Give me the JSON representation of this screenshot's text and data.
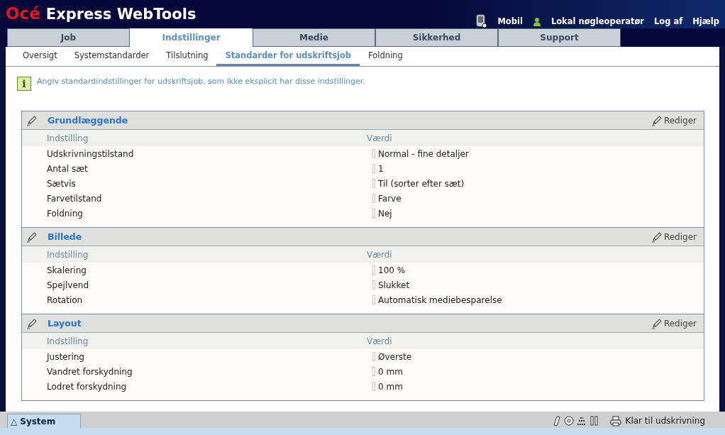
{
  "app": {
    "brand": "Océ",
    "title": "Express WebTools"
  },
  "top_links": [
    {
      "label": "Mobil",
      "kind": "mobile"
    },
    {
      "label": "Lokal nøgleoperatør",
      "kind": "user"
    },
    {
      "label": "Log af",
      "kind": "plain"
    },
    {
      "label": "Hjælp",
      "kind": "plain"
    }
  ],
  "tabs": [
    {
      "label": "Job",
      "selected": false
    },
    {
      "label": "Indstillinger",
      "selected": true
    },
    {
      "label": "Medie",
      "selected": false
    },
    {
      "label": "Sikkerhed",
      "selected": false
    },
    {
      "label": "Support",
      "selected": false
    }
  ],
  "subtabs": [
    {
      "label": "Oversigt",
      "selected": false
    },
    {
      "label": "Systemstandarder",
      "selected": false
    },
    {
      "label": "Tilslutning",
      "selected": false
    },
    {
      "label": "Standarder for udskriftsjob",
      "selected": true
    },
    {
      "label": "Foldning",
      "selected": false
    }
  ],
  "info_symbol": "i",
  "info": "Angiv standardindstillinger for udskriftsjob, som ikke eksplicit har disse indstillinger.",
  "sections": [
    {
      "title": "Grundlæggende",
      "edit": "Rediger",
      "columns": [
        "Indstilling",
        "Værdi"
      ],
      "rows": [
        [
          "Udskrivningstilstand",
          "Normal - fine detaljer"
        ],
        [
          "Antal sæt",
          "1"
        ],
        [
          "Sætvis",
          "Til (sorter efter sæt)"
        ],
        [
          "Farvetilstand",
          "Farve"
        ],
        [
          "Foldning",
          "Nej"
        ]
      ]
    },
    {
      "title": "Billede",
      "edit": "Rediger",
      "columns": [
        "Indstilling",
        "Værdi"
      ],
      "rows": [
        [
          "Skalering",
          "100 %"
        ],
        [
          "Spejlvend",
          "Slukket"
        ],
        [
          "Rotation",
          "Automatisk mediebesparelse"
        ]
      ]
    },
    {
      "title": "Layout",
      "edit": "Rediger",
      "columns": [
        "Indstilling",
        "Værdi"
      ],
      "rows": [
        [
          "Justering",
          "Øverste"
        ],
        [
          "Vandret forskydning",
          "0 mm"
        ],
        [
          "Lodret forskydning",
          "0 mm"
        ]
      ]
    }
  ],
  "status_bar": {
    "system_tab": "System",
    "system_symbol": "△",
    "status": "Klar til udskrivning"
  }
}
